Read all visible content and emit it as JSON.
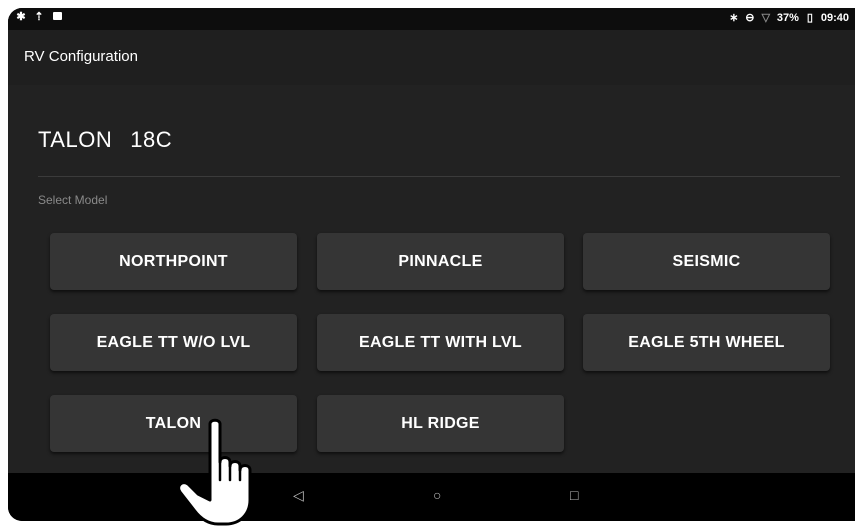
{
  "status_bar": {
    "left_icons": [
      "settings-icon",
      "upload-icon",
      "image-icon"
    ],
    "right_icons": [
      "bluetooth-icon",
      "do-not-disturb-icon",
      "wifi-icon",
      "battery-icon"
    ],
    "battery": "37%",
    "time": "09:40"
  },
  "app_bar": {
    "title": "RV Configuration"
  },
  "current": {
    "brand": "TALON",
    "model": "18C"
  },
  "select_label": "Select Model",
  "models": [
    "NORTHPOINT",
    "PINNACLE",
    "SEISMIC",
    "EAGLE TT W/O LVL",
    "EAGLE TT WITH LVL",
    "EAGLE 5TH WHEEL",
    "TALON",
    "HL RIDGE"
  ],
  "nav": {
    "back": "◁",
    "home": "○",
    "recents": "□"
  }
}
